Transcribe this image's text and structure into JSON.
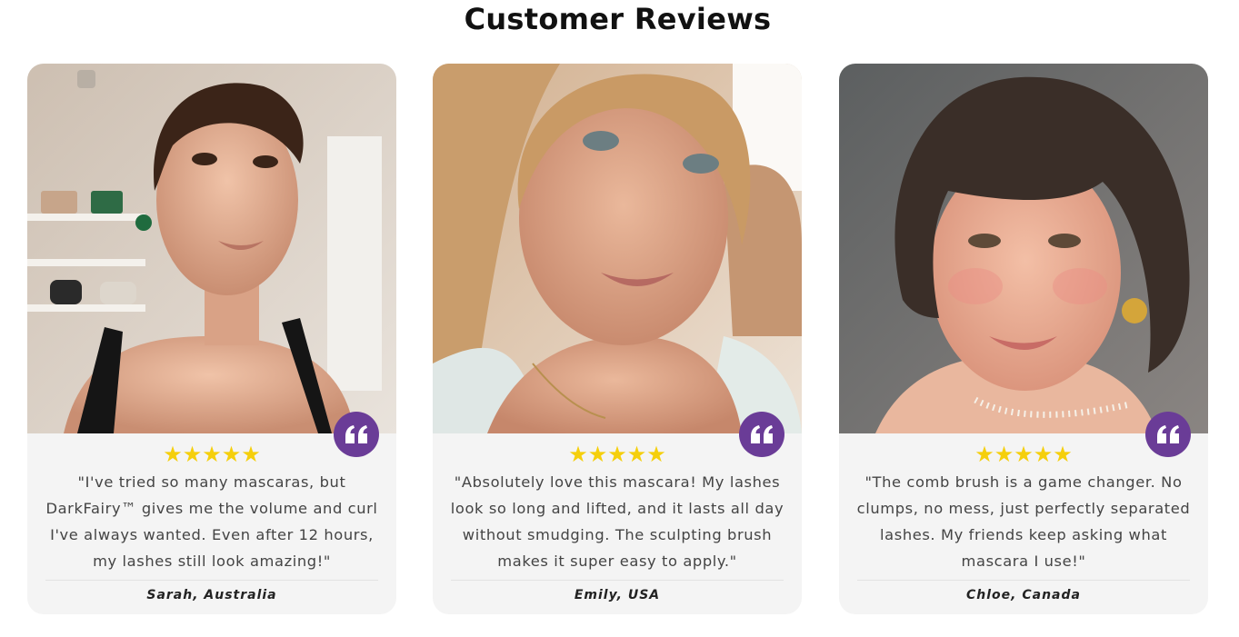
{
  "section": {
    "title": "Customer Reviews"
  },
  "colors": {
    "badge": "#6a3c97",
    "star": "#f5cf0c",
    "card_bg": "#f4f4f4",
    "text": "#444444"
  },
  "icons": {
    "quote": "quote-icon",
    "star": "star-icon"
  },
  "reviews": [
    {
      "rating": 5,
      "stars": "★★★★★",
      "text": "\"I've tried so many mascaras, but DarkFairy™ gives me the volume and curl I've always wanted. Even after 12 hours, my lashes still look amazing!\"",
      "author": "Sarah, Australia"
    },
    {
      "rating": 5,
      "stars": "★★★★★",
      "text": "\"Absolutely love this mascara! My lashes look so long and lifted, and it lasts all day without smudging. The sculpting brush makes it super easy to apply.\"",
      "author": "Emily, USA"
    },
    {
      "rating": 5,
      "stars": "★★★★★",
      "text": "\"The comb brush is a game changer. No clumps, no mess, just perfectly separated lashes. My friends keep asking what mascara I use!\"",
      "author": "Chloe, Canada"
    }
  ]
}
